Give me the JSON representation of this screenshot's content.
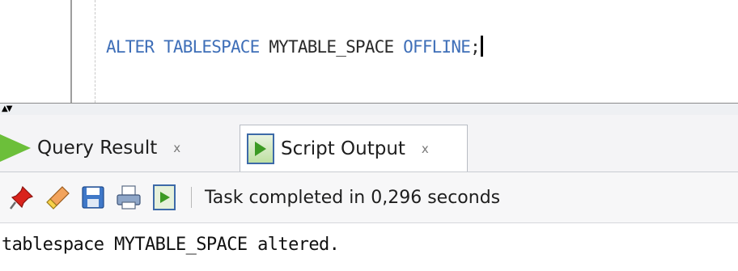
{
  "editor": {
    "tokens": [
      {
        "text": "ALTER",
        "kind": "kw"
      },
      {
        "text": " ",
        "kind": "id"
      },
      {
        "text": "TABLESPACE",
        "kind": "kw"
      },
      {
        "text": " MYTABLE_SPACE ",
        "kind": "id"
      },
      {
        "text": "OFFLINE",
        "kind": "kw"
      },
      {
        "text": ";",
        "kind": "id"
      }
    ]
  },
  "tabs": [
    {
      "label": "Query Result",
      "close": "x",
      "icon": "run-arrow-icon"
    },
    {
      "label": "Script Output",
      "close": "x",
      "icon": "script-output-icon"
    }
  ],
  "toolbar": {
    "icons": [
      "pin-icon",
      "eraser-icon",
      "save-icon",
      "print-icon",
      "script-icon"
    ],
    "status": "Task completed in 0,296 seconds"
  },
  "output": {
    "text": "tablespace MYTABLE_SPACE altered."
  },
  "colors": {
    "keyword": "#3f6fb8",
    "identifier": "#2a2a2a",
    "play_green": "#6cbf3a"
  }
}
